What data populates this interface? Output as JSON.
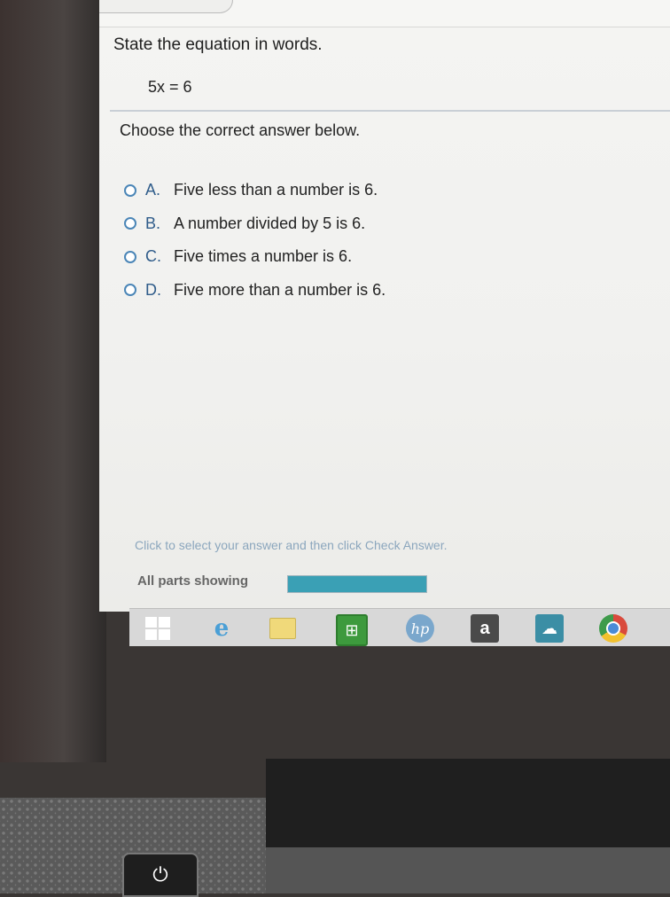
{
  "question": {
    "title": "State the equation in words.",
    "equation": "5x = 6",
    "instruction": "Choose the correct answer below."
  },
  "options": [
    {
      "letter": "A.",
      "text": "Five less than a number is 6."
    },
    {
      "letter": "B.",
      "text": "A number divided by 5 is 6."
    },
    {
      "letter": "C.",
      "text": "Five times a number is 6."
    },
    {
      "letter": "D.",
      "text": "Five more than a number is 6."
    }
  ],
  "footer": {
    "hint": "Click to select your answer and then click Check Answer.",
    "parts_label": "All parts showing",
    "progress": 1.0
  },
  "taskbar": {
    "icons": [
      "windows-start-icon",
      "internet-explorer-icon",
      "file-explorer-icon",
      "store-icon",
      "hp-icon",
      "amazon-icon",
      "cloud-icon",
      "chrome-icon"
    ],
    "amazon_letter": "a",
    "hp_text": "hp"
  },
  "colors": {
    "radio_border": "#4b86b7",
    "progress_fill": "#3aa0b5",
    "letter": "#2f5c8a"
  }
}
